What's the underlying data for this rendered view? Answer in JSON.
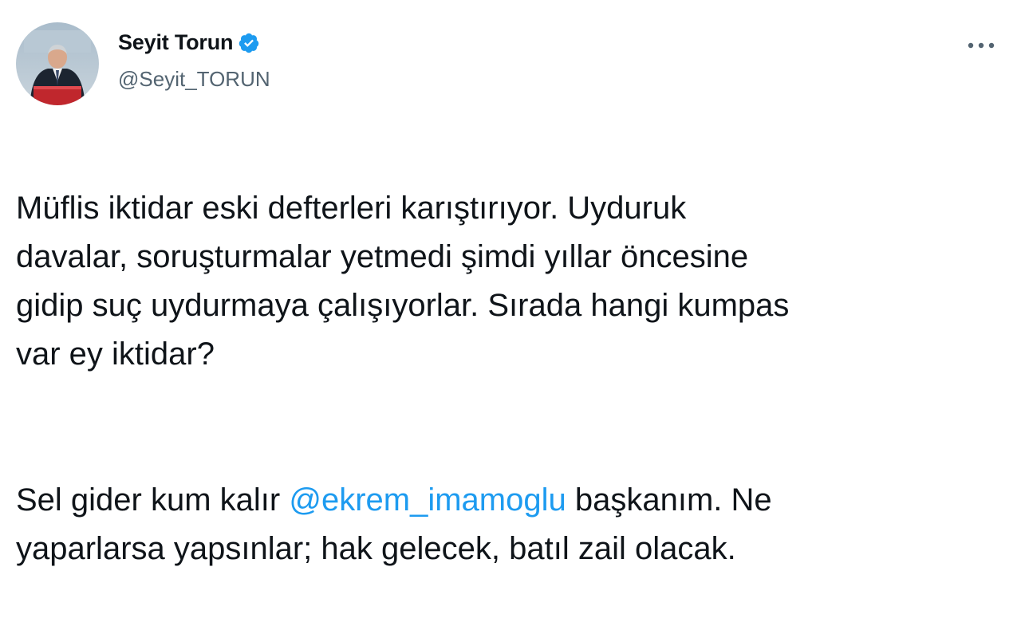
{
  "author": {
    "display_name": "Seyit Torun",
    "handle": "@Seyit_TORUN",
    "verified": true
  },
  "tweet": {
    "paragraph_1": "Müflis iktidar eski defterleri karıştırıyor. Uyduruk\ndavalar, soruşturmalar yetmedi şimdi yıllar öncesine\ngidip suç uydurmaya çalışıyorlar. Sırada hangi kumpas\nvar ey iktidar?",
    "paragraph_2_before": "Sel gider kum kalır ",
    "mention": "@ekrem_imamoglu",
    "paragraph_2_after": " başkanım. Ne\nyaparlarsa yapsınlar; hak gelecek, batıl zail olacak."
  },
  "icons": {
    "verified": "verified-badge-icon",
    "more": "more-options-icon"
  },
  "colors": {
    "text": "#0f1419",
    "secondary_text": "#536471",
    "accent": "#1d9bf0"
  }
}
